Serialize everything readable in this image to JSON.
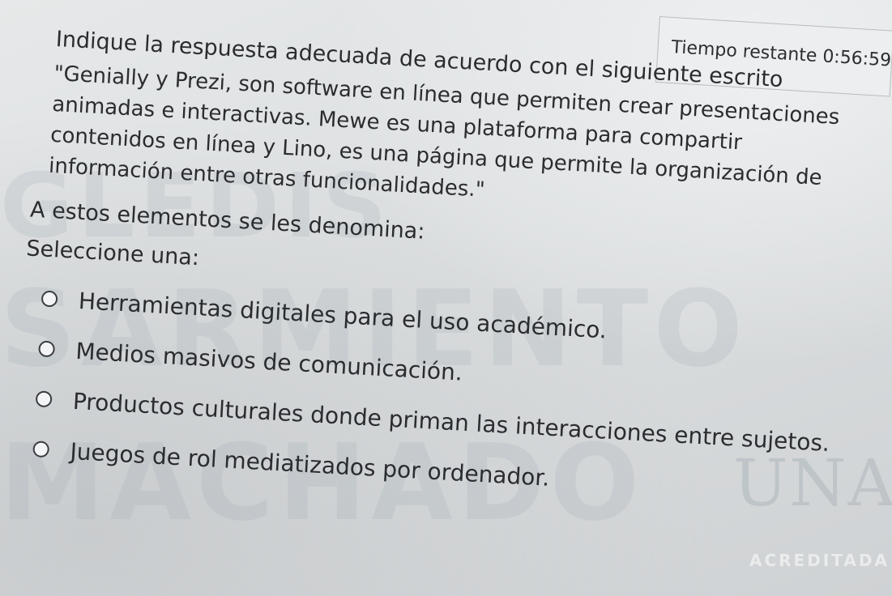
{
  "timer": {
    "label": "Tiempo restante",
    "value": "0:56:59"
  },
  "question": {
    "prompt": "Indique la respuesta adecuada de acuerdo con el siguiente escrito",
    "quote": "\"Genially y Prezi, son software en línea que permiten crear presentaciones animadas e interactivas. Mewe es una plataforma para compartir contenidos en línea y Lino, es una página que permite la organización de información entre otras funcionalidades.\"",
    "sub_prompt": "A estos elementos se les denomina:",
    "select_label": "Seleccione una:"
  },
  "options": [
    {
      "label": "Herramientas digitales para el uso académico."
    },
    {
      "label": "Medios masivos de comunicación."
    },
    {
      "label": "Productos culturales donde priman las interacciones entre sujetos."
    },
    {
      "label": "Juegos de rol mediatizados por ordenador."
    }
  ],
  "watermark": {
    "line1": "GLEDIS",
    "line2": "SARMIENTO",
    "line3": "MACHADO"
  },
  "logo": {
    "mark": "UNAD",
    "sub": "ACREDITADA"
  }
}
